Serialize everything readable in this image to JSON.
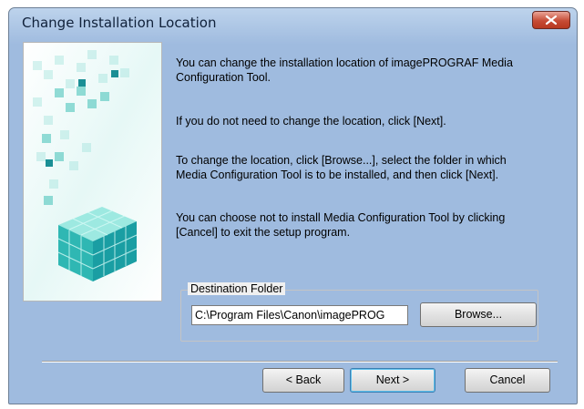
{
  "window": {
    "title": "Change Installation Location",
    "close_label": "✕"
  },
  "messages": {
    "p1_line1": "You can change the installation location of imagePROGRAF Media",
    "p1_line2": "Configuration Tool.",
    "p2": "If you do not need to change the location, click [Next].",
    "p3_line1": "To change the location, click [Browse...], select the folder in which",
    "p3_line2": "Media Configuration Tool is to be installed, and then click [Next].",
    "p4_line1": "You can choose not to install Media Configuration Tool by clicking",
    "p4_line2": "[Cancel] to exit the setup program."
  },
  "destination": {
    "label": "Destination Folder",
    "path": "C:\\Program Files\\Canon\\imagePROG",
    "browse_label": "Browse..."
  },
  "buttons": {
    "back": "< Back",
    "next": "Next >",
    "cancel": "Cancel"
  },
  "colors": {
    "banner_cube_dark": "#1ba7a4",
    "banner_cube_light": "#bfeee8",
    "dialog_face": "#f0f0f0",
    "close_button": "#c64b35"
  },
  "icons": {
    "banner": "cube-stack-illustration",
    "close": "close-icon"
  }
}
